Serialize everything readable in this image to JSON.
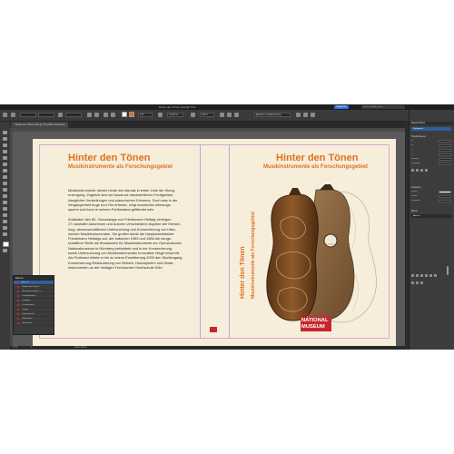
{
  "window": {
    "title": "Hinter den Tönen.indd @ 71%",
    "share_label": "Freigeben",
    "search_placeholder": "Suche in Adobe Stock"
  },
  "document_tab": "*Hinter den Tönen.indd @ 71% [GPU-Vorschau]",
  "control_bar": {
    "stroke_weight": "0 Pt",
    "opacity": "100 %",
    "frame_width": "4,233 mm",
    "style": "[Einfacher Grafikrahmen]+"
  },
  "cover": {
    "back_title": "Hinter den Tönen",
    "back_subtitle": "Musikinstrumente als Forschungsgebiet",
    "front_title": "Hinter den Tönen",
    "front_subtitle": "Musikinstrumente als Forschungsgebiet",
    "paragraph_1": "Musikinstrumente dienen heute wie damals in erster Linie der Klang-\nerzeugung. Zugleich sind sie Ausdruck handwerklicher Fertigkeiten,\nklanglicher Vorstellungen und pianerischen Könnens. Doch was in der\nVergangenheit Auge und Ohr erfreute, zeigt inzwischen Alterungs-\nspuren und kann in seinem Fortbestand gefährdet sein.",
    "paragraph_2": "Anlässlich des 80. Geburtstags von Friedemann Hellwig verfolgen\n27 namhafte Autorinnen und Autoren verschiedene Aspekte der Herstel-\nlung, wissenschaftlichen Untersuchung und Konservierung von histo-\nrischen Musikinstrumenten. Sie greifen damit die Hauptarbeitsfelder\nFriedemann Hellwigs auf, der zwischen 1963 und 1986 die neuge-\nschaffene Stelle als Restaurator für Musikinstrumente am Germanischen\nNationalmuseum in Nürnberg bekleidete und in der Konservierung\nsowie Untersuchung von Musikinstrumenten innovative Wege beschritt.\nAls Professor leitete er bis zu seiner Emeritierung 2003 den Studiengang\nKonservierung-Restaurierung von Möbeln, Holzobjekten und Musik-\ninstrumenten an der heutigen Technischen Hochschule Köln.",
    "spine_title": "Hinter den Tönen",
    "spine_subtitle": "Musikinstrumente als Forschungsgebiet",
    "museum_line1": "GERMANISCHES",
    "museum_line2": "NATIONAL",
    "museum_line3": "MUSEUM"
  },
  "status_bar": {
    "zoom": "71 %",
    "page": "1",
    "preflight": "Keine Fehler"
  },
  "layers_panel": {
    "title": "Ebenen",
    "rows": [
      {
        "label": "Ebene 1",
        "value": ""
      },
      {
        "label": "<Hinter den Tönen>",
        "value": ""
      },
      {
        "label": "<Musikinstrumente...>",
        "value": ""
      },
      {
        "label": "<Grafikrahmen>",
        "value": ""
      },
      {
        "label": "<Gruppe>",
        "value": ""
      },
      {
        "label": "<Textrahmen>",
        "value": ""
      },
      {
        "label": "<Logo>",
        "value": ""
      },
      {
        "label": "<Hintergrund>",
        "value": ""
      },
      {
        "label": "<Rechteck>",
        "value": ""
      },
      {
        "label": "<Rechteck>",
        "value": ""
      }
    ]
  },
  "properties_panel": {
    "title": "Eigenschaften",
    "selected_item": "Hintergrund",
    "section_transform": "Transformieren",
    "section_appearance": "Aussehen",
    "section_layer": "Ebene",
    "layer_value": "Ebene 1",
    "rows": [
      "B:",
      "H:",
      "X:",
      "Y:",
      "Drehung",
      "Scherung",
      "Fläche",
      "Kontur",
      "Deckkraft"
    ]
  },
  "colors": {
    "accent": "#e0701f",
    "page_background": "#f6eedb",
    "museum_red": "#c8262f",
    "selection_blue": "#2f5e9e"
  }
}
